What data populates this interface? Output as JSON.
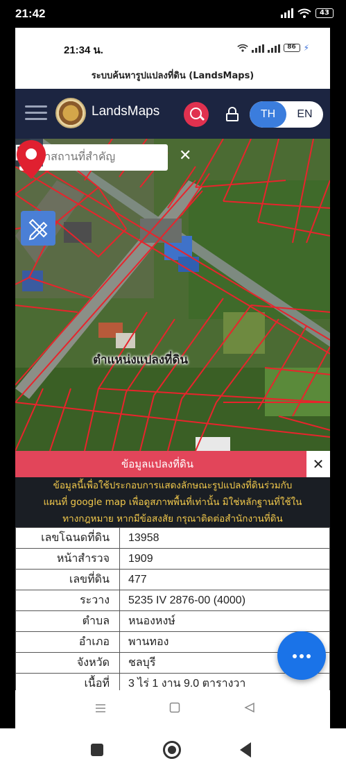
{
  "outer_status": {
    "time": "21:42",
    "battery": "43"
  },
  "inner_status": {
    "time": "21:34 น.",
    "battery": "86"
  },
  "page_title": "ระบบค้นหารูปแปลงที่ดิน (LandsMaps)",
  "navbar": {
    "brand": "LandsMaps",
    "lang_th": "TH",
    "lang_en": "EN",
    "bg_color": "#1c2541",
    "accent": "#e0314f"
  },
  "map": {
    "search_placeholder": "ค้นหาสถานที่สำคัญ",
    "clear_symbol": "✕",
    "pin_label": "ตำแหน่งแปลงที่ดิน"
  },
  "panel": {
    "title": "ข้อมูลแปลงที่ดิน",
    "close_symbol": "✕",
    "disclaimer_lines": [
      "ข้อมูลนี้เพื่อใช้ประกอบการแสดงลักษณะรูปแปลงที่ดินร่วมกับ",
      "แผนที่ google map เพื่อดูสภาพพื้นที่เท่านั้น มิใช่หลักฐานที่ใช้ใน",
      "ทางกฎหมาย หากมีข้อสงสัย กรุณาติดต่อสำนักงานที่ดิน"
    ],
    "rows": [
      {
        "label": "เลขโฉนดที่ดิน",
        "value": "13958"
      },
      {
        "label": "หน้าสำรวจ",
        "value": "1909"
      },
      {
        "label": "เลขที่ดิน",
        "value": "477"
      },
      {
        "label": "ระวาง",
        "value": "5235 IV 2876-00 (4000)"
      },
      {
        "label": "ตำบล",
        "value": "หนองหงษ์"
      },
      {
        "label": "อำเภอ",
        "value": "พานทอง"
      },
      {
        "label": "จังหวัด",
        "value": "ชลบุรี"
      },
      {
        "label": "เนื้อที่",
        "value": "3 ไร่ 1 งาน 9.0 ตารางวา"
      }
    ]
  },
  "icons": {
    "search": "search-icon",
    "lock": "lock-icon",
    "home": "home-icon",
    "grid": "grid-icon",
    "layers": "layers-icon",
    "draw": "pencil-ruler-icon",
    "pin": "map-pin-icon",
    "more": "more-icon"
  }
}
